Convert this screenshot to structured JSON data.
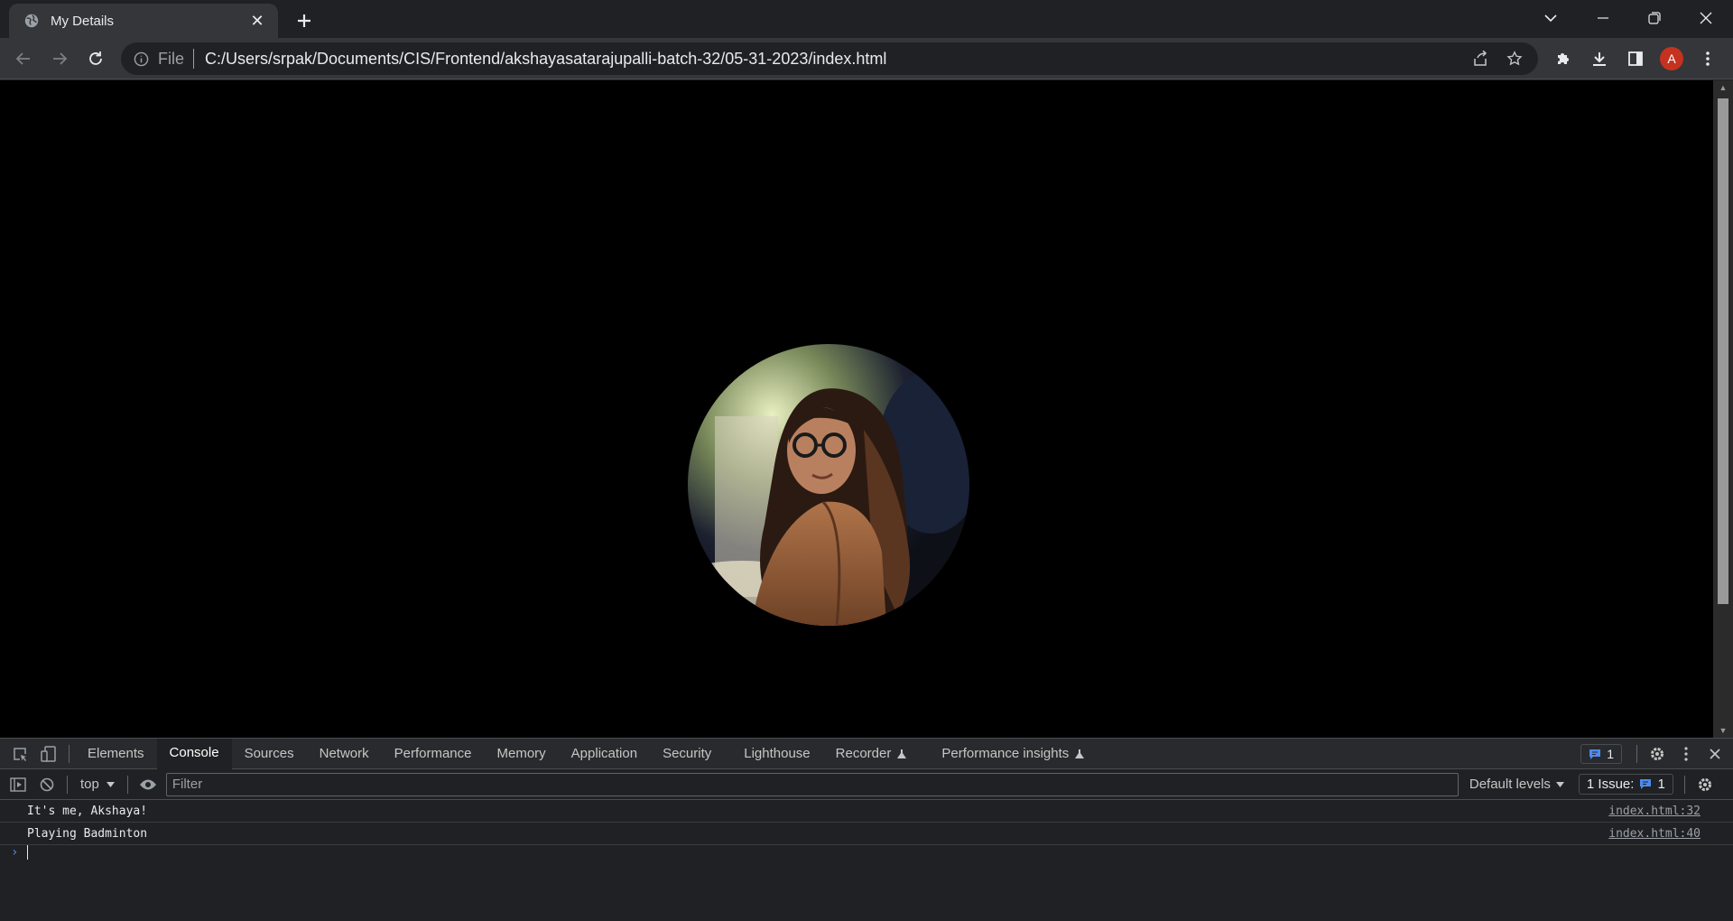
{
  "tab": {
    "title": "My Details",
    "close_glyph": "✕",
    "new_tab_glyph": "+"
  },
  "toolbar": {
    "site_label": "File",
    "url": "C:/Users/srpak/Documents/CIS/Frontend/akshayasatarajupalli-batch-32/05-31-2023/index.html",
    "profile_initial": "A"
  },
  "devtools": {
    "tabs": [
      "Elements",
      "Console",
      "Sources",
      "Network",
      "Performance",
      "Memory",
      "Application",
      "Security",
      "Lighthouse",
      "Recorder",
      "Performance insights"
    ],
    "active_tab": "Console",
    "messages_count": "1",
    "context": "top",
    "filter_placeholder": "Filter",
    "levels": "Default levels",
    "issues_label": "1 Issue:",
    "issues_count": "1",
    "logs": [
      {
        "text": "It's me, Akshaya!",
        "source": "index.html:32"
      },
      {
        "text": "Playing Badminton",
        "source": "index.html:40"
      }
    ],
    "prompt_glyph": "›"
  },
  "colors": {
    "accent": "#4d8af0",
    "avatar": "#c5321f",
    "page_bg": "#000000"
  }
}
